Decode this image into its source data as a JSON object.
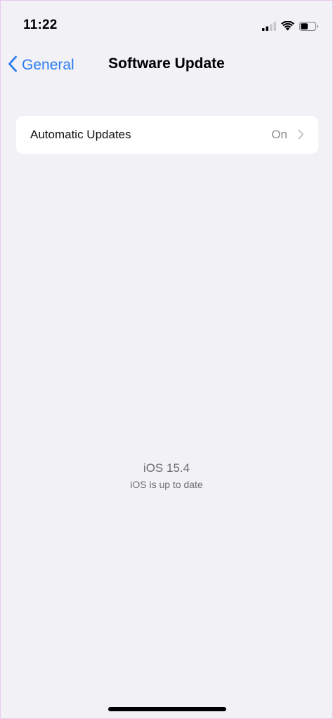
{
  "status_bar": {
    "time": "11:22",
    "icons": [
      "signal-icon",
      "wifi-icon",
      "battery-icon"
    ],
    "battery_level": 0.5
  },
  "nav": {
    "back_label": "General",
    "title": "Software Update"
  },
  "settings": {
    "automatic_updates": {
      "label": "Automatic Updates",
      "value": "On"
    }
  },
  "update_status": {
    "version": "iOS 15.4",
    "message": "iOS is up to date"
  },
  "colors": {
    "accent": "#2b7bf0",
    "background": "#f2f1f6",
    "secondary_text": "#8d8d92"
  }
}
